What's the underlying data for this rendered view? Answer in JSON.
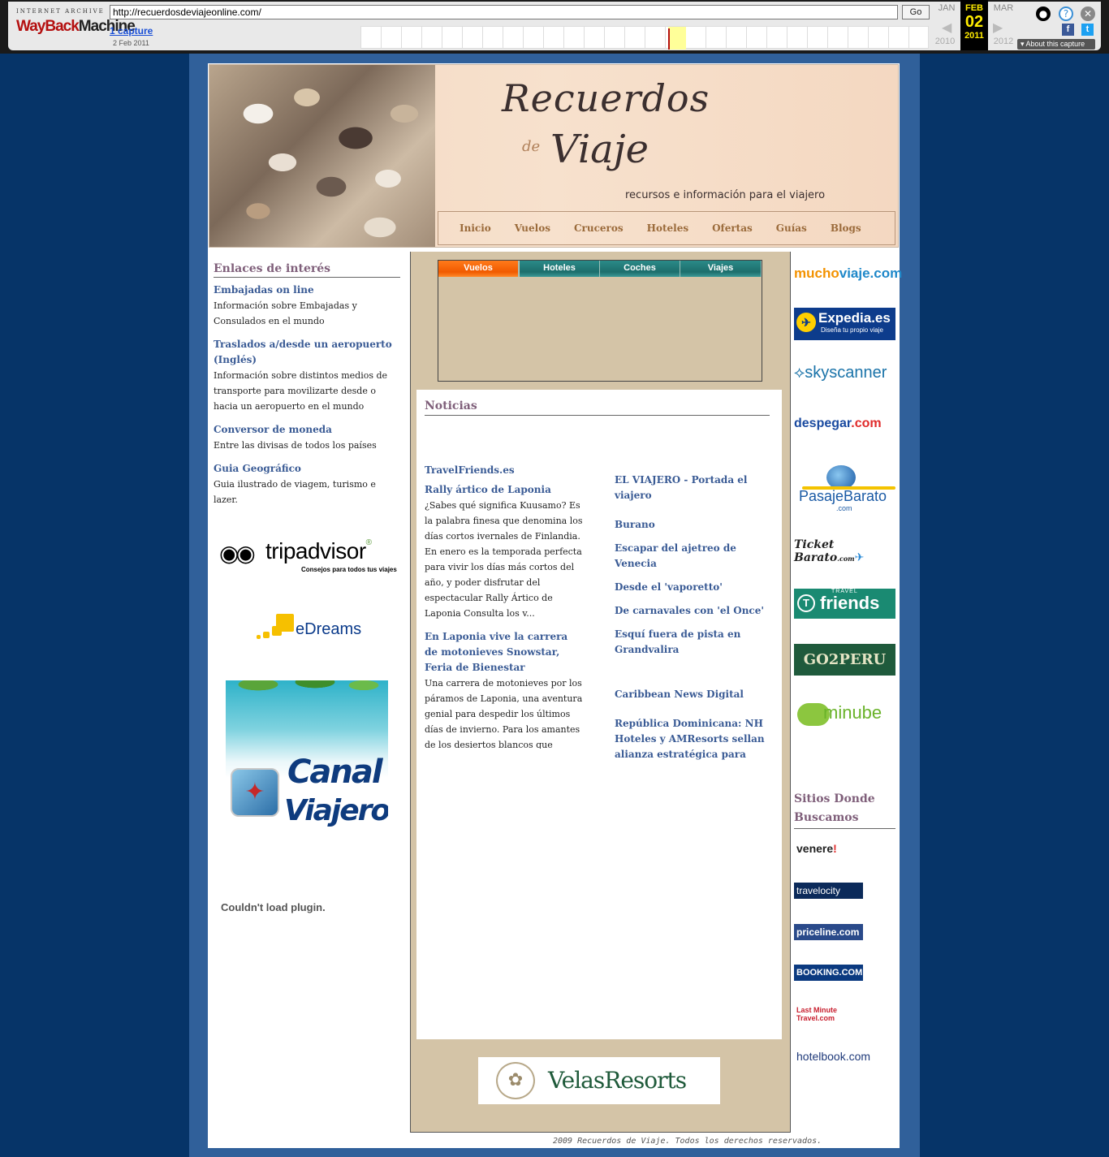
{
  "wayback": {
    "logo_top": "INTERNET ARCHIVE",
    "logo_way": "WayBack",
    "logo_machine": "Machine",
    "url": "http://recuerdosdeviajeonline.com/",
    "go_label": "Go",
    "captures": "1 capture",
    "capture_date": "2 Feb 2011",
    "prev_month": "JAN",
    "cur_month": "FEB",
    "next_month": "MAR",
    "cur_day": "02",
    "prev_year": "2010",
    "cur_year": "2011",
    "next_year": "2012",
    "about": "About this capture",
    "user_icon": "user-icon",
    "help_icon": "help-icon",
    "close_icon": "close-icon"
  },
  "header": {
    "logo_line1": "Recuerdos",
    "logo_de": "de",
    "logo_line2": "Viaje",
    "tagline": "recursos e información para el viajero",
    "nav": [
      "Inicio",
      "Vuelos",
      "Cruceros",
      "Hoteles",
      "Ofertas",
      "Guías",
      "Blogs"
    ]
  },
  "left": {
    "title": "Enlaces de interés",
    "links": [
      {
        "title": "Embajadas on line",
        "desc": "Información sobre Embajadas y Consulados en el mundo"
      },
      {
        "title": "Traslados a/desde un aeropuerto (Inglés)",
        "desc": "Información sobre distintos medios de transporte para movilizarte desde o hacia un aeropuerto en el mundo"
      },
      {
        "title": "Conversor de moneda",
        "desc": "Entre las divisas de todos los países"
      },
      {
        "title": "Guia Geográfico",
        "desc": "Guia ilustrado de viagem, turismo e lazer."
      }
    ],
    "tripadvisor": {
      "name": "tripadvisor",
      "reg": "®",
      "slogan": "Consejos para todos tus viajes"
    },
    "edreams": "eDreams",
    "canal": {
      "line1": "Canal",
      "line2": "Viajero"
    },
    "plugin_msg": "Couldn't load plugin."
  },
  "search": {
    "tabs": [
      "Vuelos",
      "Hoteles",
      "Coches",
      "Viajes"
    ],
    "active_tab": "Vuelos"
  },
  "news": {
    "title": "Noticias",
    "left_source": "TravelFriends.es",
    "left_items": [
      {
        "title": "Rally ártico de Laponia",
        "body": "¿Sabes qué significa Kuusamo? Es la palabra finesa que denomina los días cortos ivernales de Finlandia. En enero es la temporada perfecta para vivir los días más cortos del año, y poder disfrutar del espectacular Rally Ártico de Laponia Consulta los v..."
      },
      {
        "title": "En Laponia vive la carrera de motonieves Snowstar, Feria de Bienestar",
        "body": "Una carrera de motonieves por los páramos de Laponia, una aventura genial para despedir los últimos días de invierno. Para los amantes de los desiertos blancos que quieren"
      }
    ],
    "right_source": "EL VIAJERO - Portada el viajero",
    "right_items": [
      "Burano",
      "Escapar del ajetreo de Venecia",
      "Desde el 'vaporetto'",
      "De carnavales con 'el Once'",
      "Esquí fuera de pista en Grandvalira"
    ],
    "right_source2": "Caribbean News Digital",
    "right_items2": [
      "República Dominicana: NH Hoteles y AMResorts sellan alianza estratégica para"
    ]
  },
  "velas": "VelasResorts",
  "footer": "2009 Recuerdos de Viaje. Todos los derechos reservados.",
  "right": {
    "muchoviaje_a": "mucho",
    "muchoviaje_b": "viaje.com",
    "expedia": "Expedia.es",
    "expedia_slogan": "Diseña tu propio viaje",
    "skyscanner": "skyscanner",
    "despegar_a": "despegar",
    "despegar_b": ".com",
    "pasaje": "PasajeBarato",
    "pasaje_com": ".com",
    "ticket": "Ticket Barato",
    "ticket_com": ".com",
    "travelfriends_top": "TRAVEL",
    "travelfriends": "friends",
    "go2peru": "GO2PERU",
    "minube": "minube",
    "sitios_title": "Sitios Donde Buscamos",
    "venere": "venere",
    "venere_ex": "!",
    "travelocity": "travelocity",
    "priceline": "priceline.com",
    "booking": "BOOKING.COM",
    "lastminute_1": "Last Minute",
    "lastminute_2": "Travel.com",
    "hotelbook": "hotelbook.com"
  }
}
